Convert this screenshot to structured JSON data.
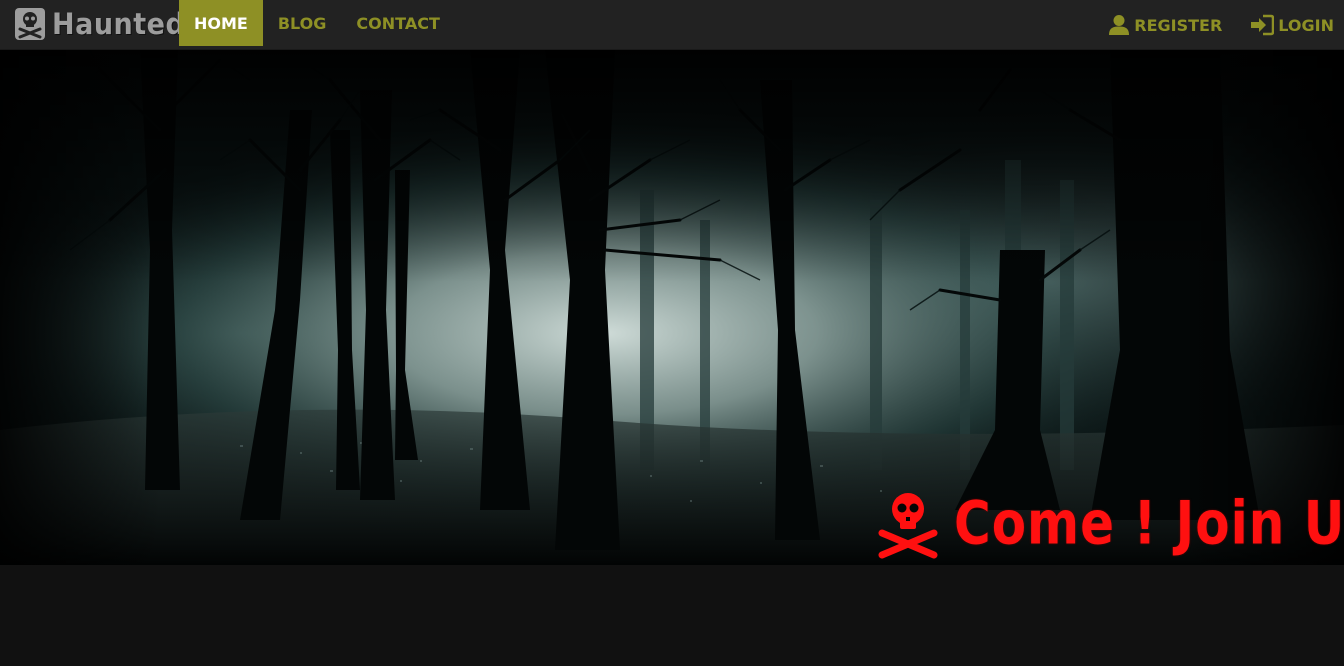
{
  "brand": {
    "icon": "skull-crossbones-icon",
    "name": "Haunted"
  },
  "nav": {
    "items": [
      {
        "label": "Home",
        "active": true
      },
      {
        "label": "Blog",
        "active": false
      },
      {
        "label": "Contact",
        "active": false
      }
    ],
    "right": [
      {
        "label": "Register",
        "icon": "user-icon"
      },
      {
        "label": "Login",
        "icon": "login-icon"
      }
    ]
  },
  "hero": {
    "image": "foggy-forest-at-night",
    "cta_icon": "skull-crossbones-icon",
    "cta_text": "Come ! Join Us!"
  },
  "colors": {
    "navbar": "#222222",
    "accent": "#8e9025",
    "brand_text": "#9d9d9d",
    "cta": "#ff1010",
    "page_background": "#111111"
  }
}
